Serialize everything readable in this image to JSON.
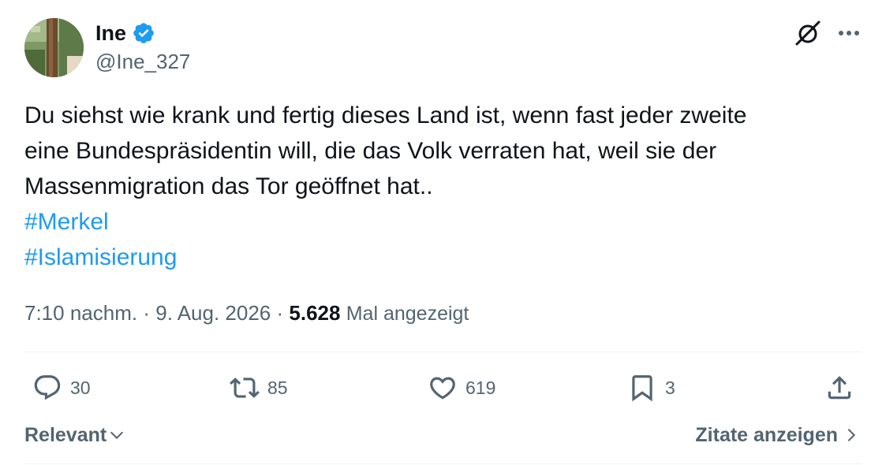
{
  "author": {
    "display_name": "Ine",
    "handle": "@Ine_327",
    "verified": true
  },
  "header_icons": {
    "grok": "grok-icon",
    "more": "more-icon"
  },
  "tweet": {
    "lines": [
      "Du siehst wie krank und fertig dieses Land ist, wenn fast jeder zweite",
      "eine Bundespräsidentin will, die das Volk verraten hat, weil sie der",
      "Massenmigration das Tor geöffnet hat.."
    ],
    "hashtags": [
      "#Merkel",
      "#Islamisierung"
    ]
  },
  "meta": {
    "time": "7:10 nachm.",
    "separator1": "·",
    "date": "9. Aug. 2026",
    "separator2": "·",
    "views_count": "5.628",
    "views_label": "Mal angezeigt"
  },
  "actions": {
    "replies": "30",
    "reposts": "85",
    "likes": "619",
    "bookmarks": "3"
  },
  "footer": {
    "sort_label": "Relevant",
    "quotes_label": "Zitate anzeigen"
  },
  "colors": {
    "accent": "#1d9bf0",
    "text": "#0f1419",
    "secondary": "#536471",
    "divider": "#eff3f4"
  }
}
